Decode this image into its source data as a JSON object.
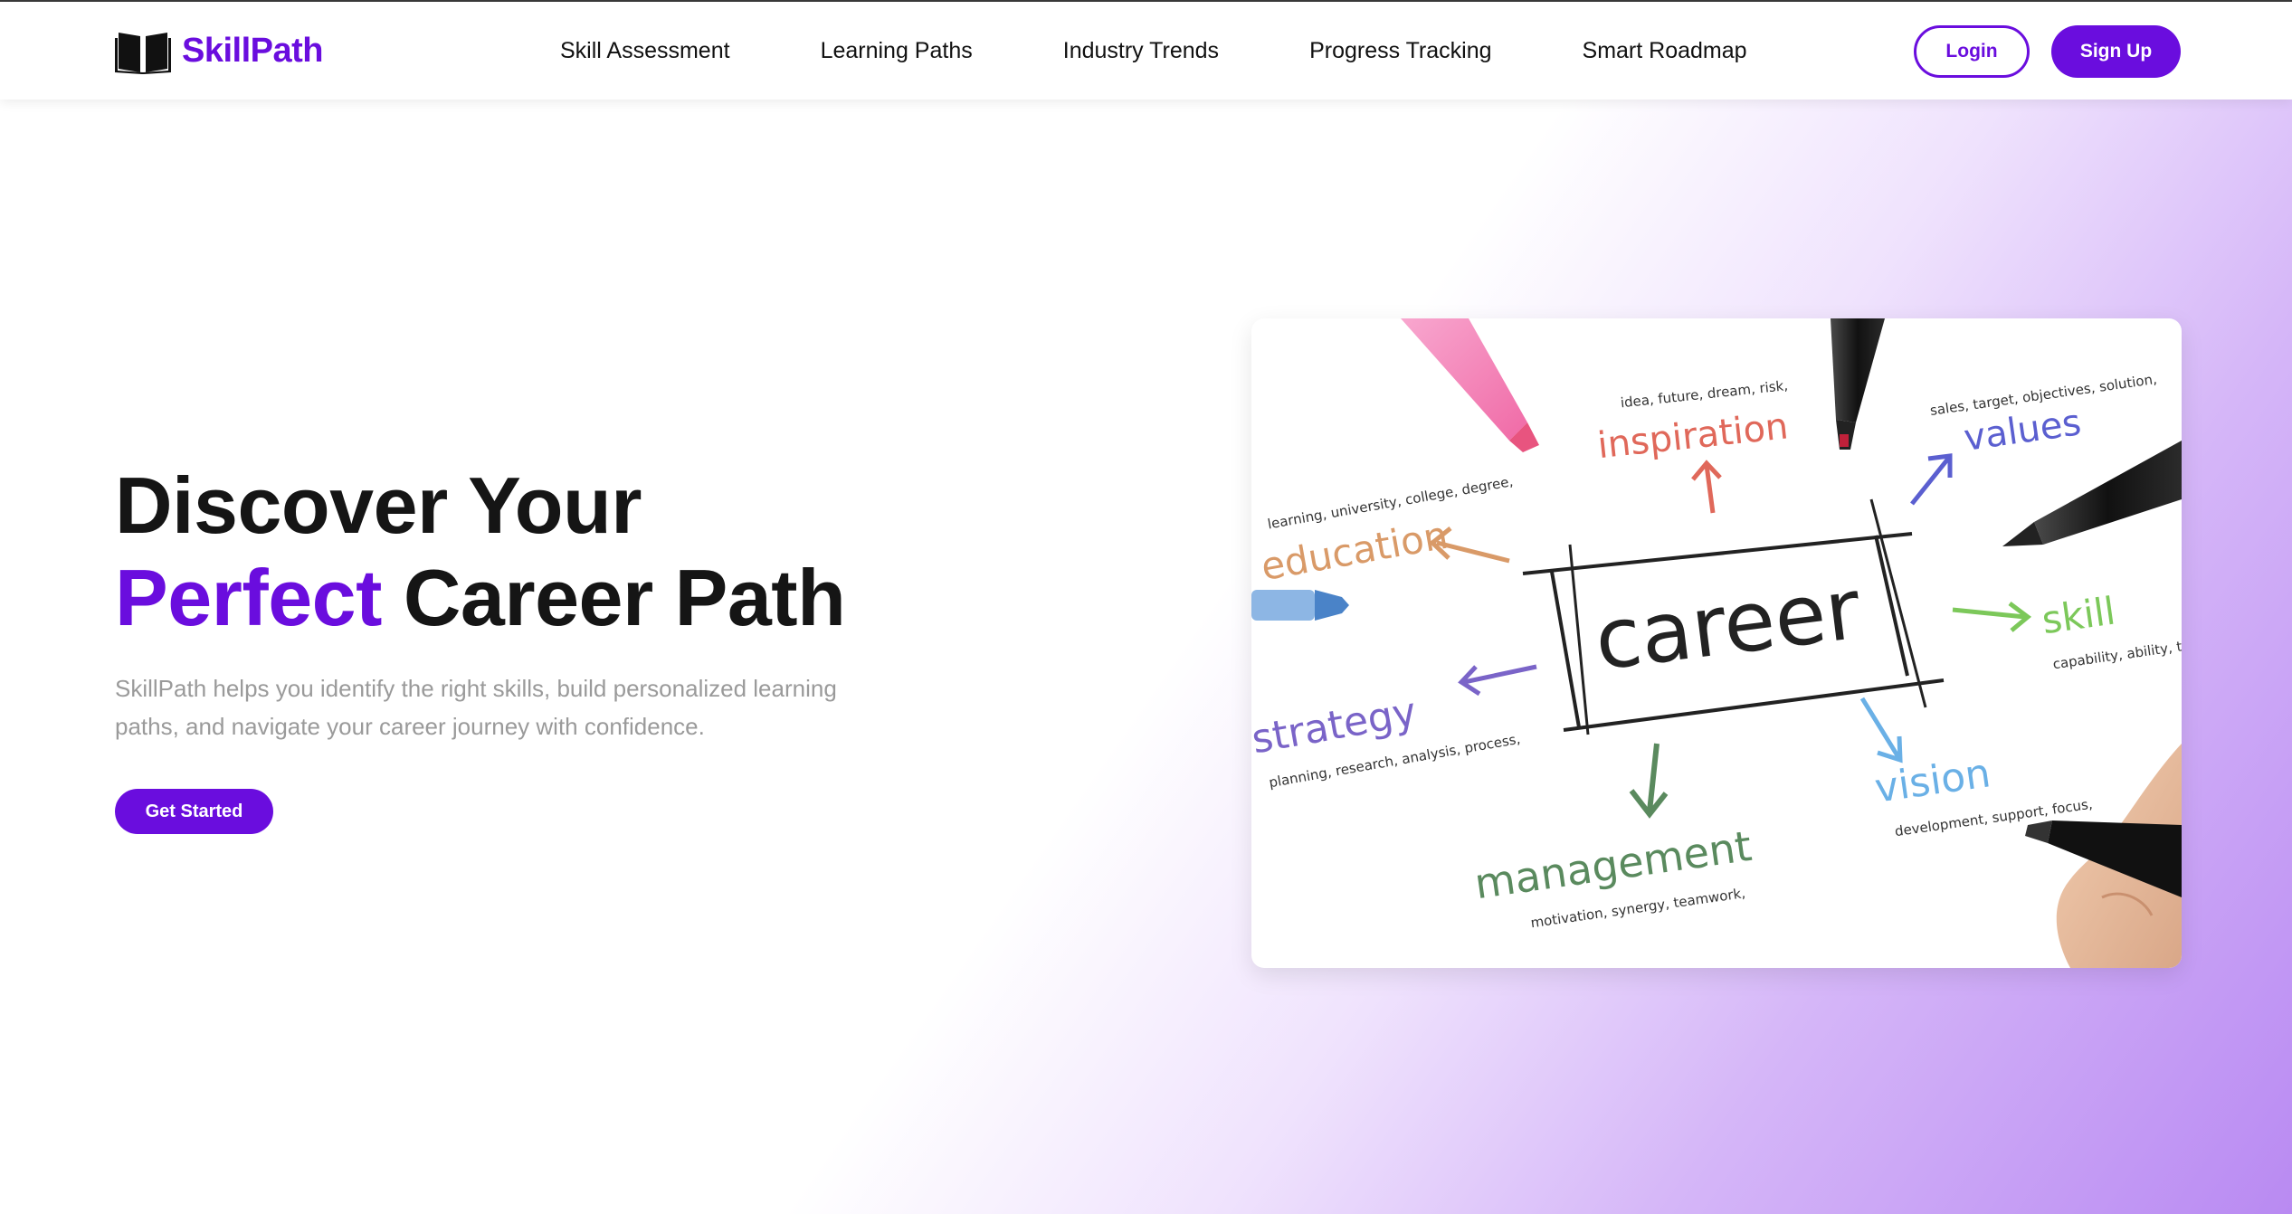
{
  "brand": {
    "name": "SkillPath",
    "icon": "open-book-icon",
    "color": "#6a0dde"
  },
  "nav": {
    "links": [
      {
        "label": "Skill Assessment"
      },
      {
        "label": "Learning Paths"
      },
      {
        "label": "Industry Trends"
      },
      {
        "label": "Progress Tracking"
      },
      {
        "label": "Smart Roadmap"
      }
    ]
  },
  "auth": {
    "login_label": "Login",
    "signup_label": "Sign Up"
  },
  "hero": {
    "title_line1": "Discover Your",
    "title_accent": "Perfect",
    "title_rest": "Career Path",
    "description": "SkillPath helps you identify the right skills, build personalized learning paths, and navigate your career journey with confidence.",
    "cta_label": "Get Started"
  },
  "illustration": {
    "center_word": "career",
    "branches": [
      {
        "word": "inspiration",
        "sub": "idea, future, dream, risk,",
        "color": "#e0685a"
      },
      {
        "word": "values",
        "sub": "sales, target, objectives, solution,",
        "color": "#5b5fd0"
      },
      {
        "word": "education",
        "sub": "learning, university, college, degree,",
        "color": "#d99a68"
      },
      {
        "word": "skill",
        "sub": "capability, ability, talent,",
        "color": "#7cc85a"
      },
      {
        "word": "strategy",
        "sub": "planning, research, analysis, process,",
        "color": "#7a64c8"
      },
      {
        "word": "vision",
        "sub": "development, support, focus,",
        "color": "#6ab0e6"
      },
      {
        "word": "management",
        "sub": "motivation, synergy, teamwork,",
        "color": "#5a8a5e"
      }
    ]
  },
  "colors": {
    "accent": "#6a0dde",
    "title_text": "#151515",
    "muted_text": "#9a9a9a"
  }
}
